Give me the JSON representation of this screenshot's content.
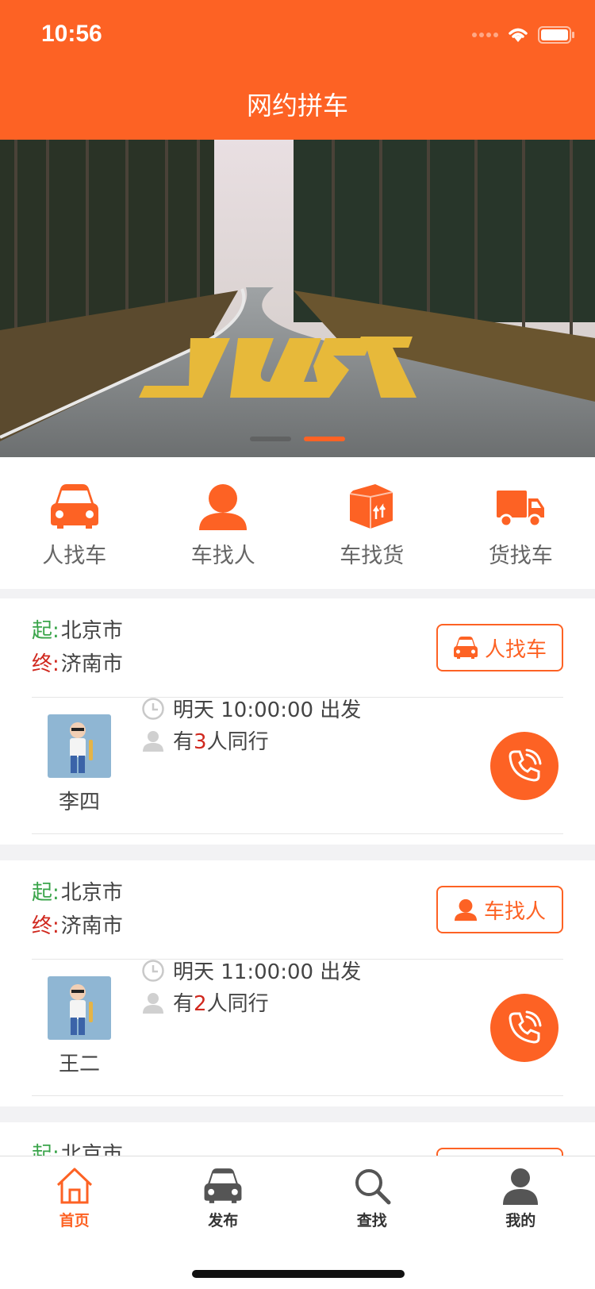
{
  "status_bar": {
    "time": "10:56"
  },
  "header": {
    "title": "网约拼车"
  },
  "banner": {
    "text": "JUST",
    "active_dot": 1,
    "dot_count": 2
  },
  "menu": [
    {
      "label": "人找车",
      "icon": "car-icon"
    },
    {
      "label": "车找人",
      "icon": "person-icon"
    },
    {
      "label": "车找货",
      "icon": "package-icon"
    },
    {
      "label": "货找车",
      "icon": "truck-icon"
    }
  ],
  "rides": [
    {
      "start_key": "起:",
      "start": "北京市",
      "end_key": "终:",
      "end": "济南市",
      "tag": "人找车",
      "tag_icon": "car-icon",
      "name": "李四",
      "time_text": "明天 10:00:00 出发",
      "companions_prefix": "有",
      "companions": "3",
      "companions_suffix": "人同行"
    },
    {
      "start_key": "起:",
      "start": "北京市",
      "end_key": "终:",
      "end": "济南市",
      "tag": "车找人",
      "tag_icon": "person-icon",
      "name": "王二",
      "time_text": "明天 11:00:00 出发",
      "companions_prefix": "有",
      "companions": "2",
      "companions_suffix": "人同行"
    },
    {
      "start_key": "起:",
      "start": "北京市"
    }
  ],
  "tabbar": [
    {
      "label": "首页",
      "icon": "home-icon",
      "active": true
    },
    {
      "label": "发布",
      "icon": "car-icon"
    },
    {
      "label": "查找",
      "icon": "search-icon"
    },
    {
      "label": "我的",
      "icon": "user-icon"
    }
  ],
  "colors": {
    "brand": "#fd6224",
    "start": "#3aa44a",
    "end": "#d0281e"
  }
}
